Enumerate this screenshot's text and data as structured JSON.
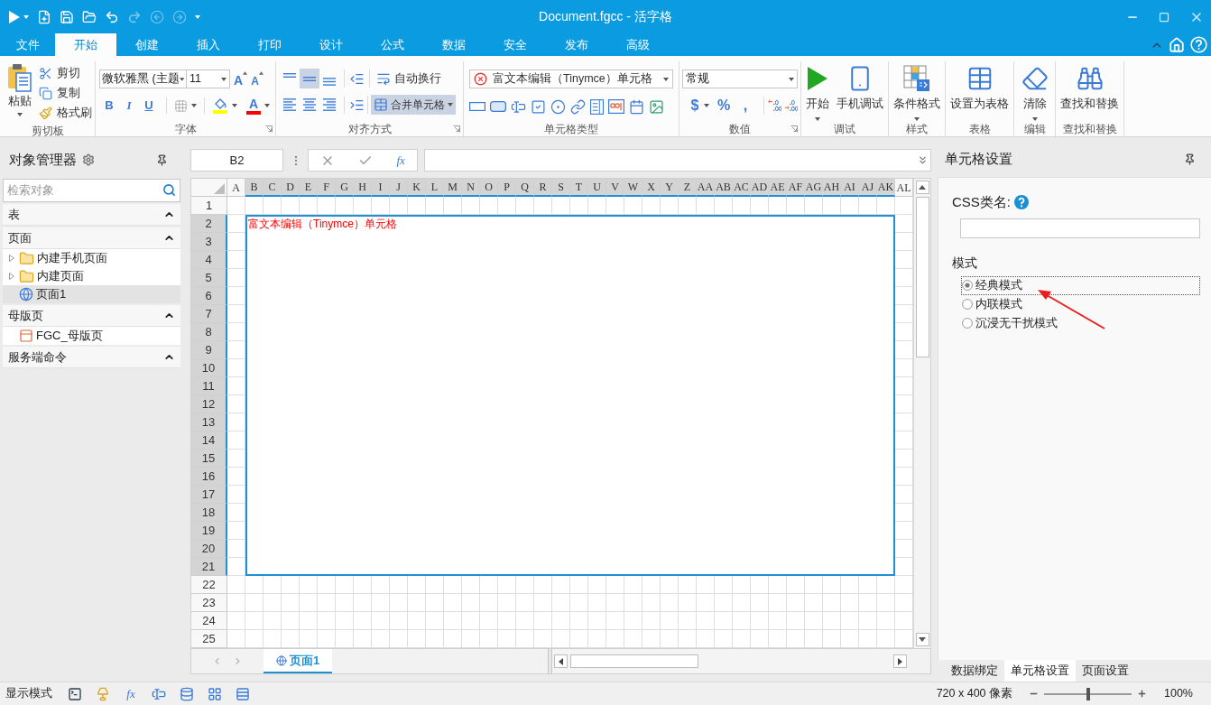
{
  "title_bar": {
    "title": "Document.fgcc - 活字格"
  },
  "quick_access": [
    {
      "kind": "run",
      "disabled": false
    },
    {
      "kind": "new",
      "disabled": false
    },
    {
      "kind": "save",
      "disabled": false
    },
    {
      "kind": "open",
      "disabled": false
    },
    {
      "kind": "undo",
      "disabled": false
    },
    {
      "kind": "redo",
      "disabled": true
    },
    {
      "kind": "back",
      "disabled": true
    },
    {
      "kind": "forward",
      "disabled": true
    }
  ],
  "menu_tabs": [
    {
      "label": "文件",
      "selected": false
    },
    {
      "label": "开始",
      "selected": true
    },
    {
      "label": "创建",
      "selected": false
    },
    {
      "label": "插入",
      "selected": false
    },
    {
      "label": "打印",
      "selected": false
    },
    {
      "label": "设计",
      "selected": false
    },
    {
      "label": "公式",
      "selected": false
    },
    {
      "label": "数据",
      "selected": false
    },
    {
      "label": "安全",
      "selected": false
    },
    {
      "label": "发布",
      "selected": false
    },
    {
      "label": "高级",
      "selected": false
    }
  ],
  "ribbon": {
    "groups": [
      {
        "kind": "clipboard",
        "label": "剪切板",
        "launcher": false,
        "paste": "粘贴",
        "actions": [
          {
            "kind": "cut",
            "label": "剪切"
          },
          {
            "kind": "copy",
            "label": "复制"
          },
          {
            "kind": "format_painter",
            "label": "格式刷"
          }
        ]
      },
      {
        "kind": "font",
        "label": "字体",
        "launcher": true,
        "font_name": "微软雅黑 (主题",
        "font_size": "11",
        "size_buttons": [
          {
            "kind": "grow",
            "label": "A"
          },
          {
            "kind": "shrink",
            "label": "A"
          }
        ],
        "style_buttons": [
          {
            "kind": "bold",
            "label": "B"
          },
          {
            "kind": "italic",
            "label": "I"
          },
          {
            "kind": "underline",
            "label": "U"
          }
        ],
        "font_color_label": "A"
      },
      {
        "kind": "alignment",
        "label": "对齐方式",
        "launcher": true,
        "vertical": [
          {
            "kind": "top",
            "selected": false
          },
          {
            "kind": "middle",
            "selected": true
          },
          {
            "kind": "bottom",
            "selected": false
          }
        ],
        "horizontal": [
          {
            "kind": "left",
            "selected": false
          },
          {
            "kind": "center",
            "selected": false
          },
          {
            "kind": "right",
            "selected": false
          }
        ],
        "wrap": {
          "label": "自动换行",
          "on": false
        },
        "merge": {
          "label": "合并单元格",
          "on": true
        }
      },
      {
        "kind": "cell_type",
        "label": "单元格类型",
        "launcher": false,
        "value": "富文本编辑（Tinymce）单元格"
      },
      {
        "kind": "number",
        "label": "数值",
        "launcher": true,
        "format": "常规",
        "buttons": [
          "$",
          "%",
          ","
        ]
      },
      {
        "kind": "large",
        "label": "调试",
        "launcher": false,
        "buttons": [
          {
            "kind": "start",
            "label": "开始",
            "menu": true
          },
          {
            "kind": "mobile",
            "label": "手机调试",
            "menu": false
          }
        ]
      },
      {
        "kind": "large",
        "label": "样式",
        "launcher": false,
        "buttons": [
          {
            "kind": "conditional_format",
            "label": "条件格式",
            "menu": true
          }
        ]
      },
      {
        "kind": "large",
        "label": "表格",
        "launcher": false,
        "buttons": [
          {
            "kind": "table",
            "label": "设置为表格",
            "menu": false
          }
        ]
      },
      {
        "kind": "large",
        "label": "编辑",
        "launcher": false,
        "buttons": [
          {
            "kind": "clear",
            "label": "清除",
            "menu": true
          }
        ]
      },
      {
        "kind": "large",
        "label": "查找和替换",
        "launcher": false,
        "buttons": [
          {
            "kind": "find",
            "label": "查找和替换",
            "menu": false
          }
        ]
      }
    ]
  },
  "object_manager": {
    "title": "对象管理器",
    "search_placeholder": "检索对象",
    "sections": [
      {
        "title": "表",
        "expanded": true
      },
      {
        "title": "页面",
        "expanded": true,
        "items": [
          {
            "kind": "folder",
            "label": "内建手机页面",
            "expanded": false,
            "selected": false
          },
          {
            "kind": "folder",
            "label": "内建页面",
            "expanded": false,
            "selected": false
          },
          {
            "kind": "page",
            "label": "页面1",
            "selected": true
          }
        ]
      },
      {
        "title": "母版页",
        "expanded": true,
        "items": [
          {
            "kind": "master_page",
            "label": "FGC_母版页",
            "selected": false
          }
        ]
      },
      {
        "title": "服务端命令",
        "expanded": true
      }
    ]
  },
  "formula_bar": {
    "name_box": "B2",
    "function_label": "fx"
  },
  "sheet": {
    "columns": [
      {
        "label": "A",
        "selected": false
      },
      {
        "label": "B",
        "selected": true
      },
      {
        "label": "C",
        "selected": true
      },
      {
        "label": "D",
        "selected": true
      },
      {
        "label": "E",
        "selected": true
      },
      {
        "label": "F",
        "selected": true
      },
      {
        "label": "G",
        "selected": true
      },
      {
        "label": "H",
        "selected": true
      },
      {
        "label": "I",
        "selected": true
      },
      {
        "label": "J",
        "selected": true
      },
      {
        "label": "K",
        "selected": true
      },
      {
        "label": "L",
        "selected": true
      },
      {
        "label": "M",
        "selected": true
      },
      {
        "label": "N",
        "selected": true
      },
      {
        "label": "O",
        "selected": true
      },
      {
        "label": "P",
        "selected": true
      },
      {
        "label": "Q",
        "selected": true
      },
      {
        "label": "R",
        "selected": true
      },
      {
        "label": "S",
        "selected": true
      },
      {
        "label": "T",
        "selected": true
      },
      {
        "label": "U",
        "selected": true
      },
      {
        "label": "V",
        "selected": true
      },
      {
        "label": "W",
        "selected": true
      },
      {
        "label": "X",
        "selected": true
      },
      {
        "label": "Y",
        "selected": true
      },
      {
        "label": "Z",
        "selected": true
      },
      {
        "label": "AA",
        "selected": true
      },
      {
        "label": "AB",
        "selected": true
      },
      {
        "label": "AC",
        "selected": true
      },
      {
        "label": "AD",
        "selected": true
      },
      {
        "label": "AE",
        "selected": true
      },
      {
        "label": "AF",
        "selected": true
      },
      {
        "label": "AG",
        "selected": true
      },
      {
        "label": "AH",
        "selected": true
      },
      {
        "label": "AI",
        "selected": true
      },
      {
        "label": "AJ",
        "selected": true
      },
      {
        "label": "AK",
        "selected": true
      },
      {
        "label": "AL",
        "selected": false
      }
    ],
    "rows": [
      {
        "label": "1",
        "selected": false
      },
      {
        "label": "2",
        "selected": true
      },
      {
        "label": "3",
        "selected": true
      },
      {
        "label": "4",
        "selected": true
      },
      {
        "label": "5",
        "selected": true
      },
      {
        "label": "6",
        "selected": true
      },
      {
        "label": "7",
        "selected": true
      },
      {
        "label": "8",
        "selected": true
      },
      {
        "label": "9",
        "selected": true
      },
      {
        "label": "10",
        "selected": true
      },
      {
        "label": "11",
        "selected": true
      },
      {
        "label": "12",
        "selected": true
      },
      {
        "label": "13",
        "selected": true
      },
      {
        "label": "14",
        "selected": true
      },
      {
        "label": "15",
        "selected": true
      },
      {
        "label": "16",
        "selected": true
      },
      {
        "label": "17",
        "selected": true
      },
      {
        "label": "18",
        "selected": true
      },
      {
        "label": "19",
        "selected": true
      },
      {
        "label": "20",
        "selected": true
      },
      {
        "label": "21",
        "selected": true
      },
      {
        "label": "22",
        "selected": false
      },
      {
        "label": "23",
        "selected": false
      },
      {
        "label": "24",
        "selected": false
      },
      {
        "label": "25",
        "selected": false
      }
    ],
    "cell": {
      "text": "富文本编辑（Tinymce）单元格",
      "selected": true
    },
    "tabs": [
      {
        "label": "页面1",
        "selected": true
      }
    ]
  },
  "cell_settings": {
    "title": "单元格设置",
    "css_label": "CSS类名:",
    "mode_label": "模式",
    "modes": [
      {
        "label": "经典模式",
        "selected": true
      },
      {
        "label": "内联模式",
        "selected": false
      },
      {
        "label": "沉浸无干扰模式",
        "selected": false
      }
    ]
  },
  "panel_tabs": [
    {
      "label": "数据绑定",
      "selected": false
    },
    {
      "label": "单元格设置",
      "selected": true
    },
    {
      "label": "页面设置",
      "selected": false
    }
  ],
  "status_bar": {
    "mode_label": "显示模式",
    "formula_label": "fx",
    "size": "720 x 400 像素",
    "zoom": {
      "level": 0.5
    },
    "zoom_text": "100%"
  }
}
